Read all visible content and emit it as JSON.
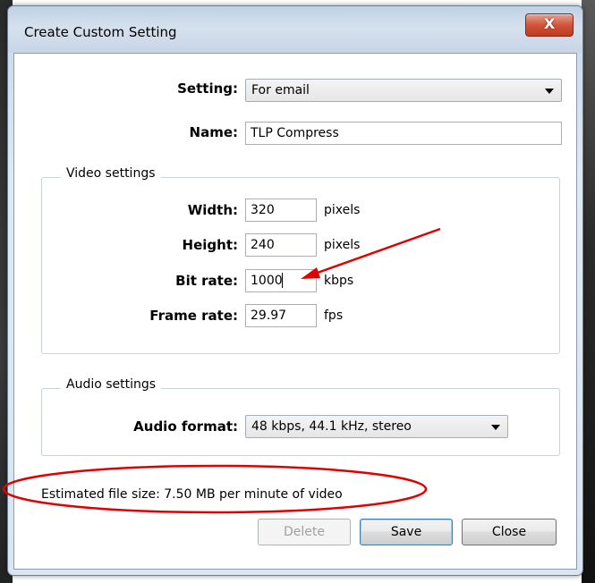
{
  "dialog": {
    "title": "Create Custom Setting",
    "close_glyph": "X"
  },
  "fields": {
    "setting_label": "Setting:",
    "setting_value": "For email",
    "name_label": "Name:",
    "name_value": "TLP Compress"
  },
  "video": {
    "group_title": "Video settings",
    "width_label": "Width:",
    "width_value": "320",
    "width_unit": "pixels",
    "height_label": "Height:",
    "height_value": "240",
    "height_unit": "pixels",
    "bitrate_label": "Bit rate:",
    "bitrate_value": "1000",
    "bitrate_unit": "kbps",
    "framerate_label": "Frame rate:",
    "framerate_value": "29.97",
    "framerate_unit": "fps"
  },
  "audio": {
    "group_title": "Audio settings",
    "format_label": "Audio format:",
    "format_value": "48 kbps, 44.1 kHz, stereo"
  },
  "estimate": {
    "text": "Estimated file size: 7.50 MB per minute of video"
  },
  "buttons": {
    "delete": "Delete",
    "save": "Save",
    "close": "Close"
  },
  "annotation_colors": {
    "accent": "#e00000"
  }
}
